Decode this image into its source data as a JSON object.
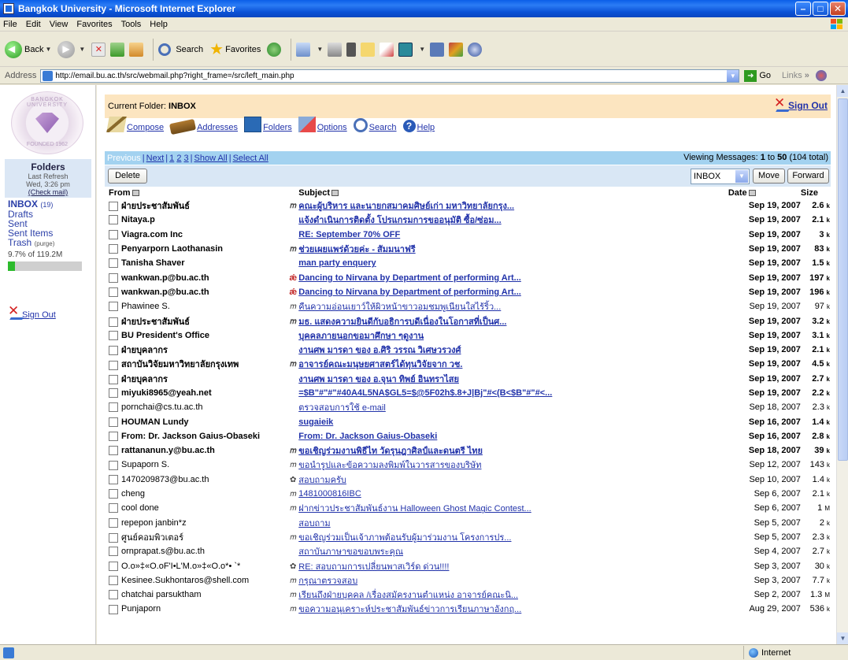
{
  "window": {
    "title": "Bangkok University - Microsoft Internet Explorer"
  },
  "menu": [
    "File",
    "Edit",
    "View",
    "Favorites",
    "Tools",
    "Help"
  ],
  "toolbar": {
    "back": "Back",
    "search": "Search",
    "favorites": "Favorites"
  },
  "address": {
    "label": "Address",
    "url": "http://email.bu.ac.th/src/webmail.php?right_frame=/src/left_main.php",
    "go": "Go",
    "links": "Links"
  },
  "left": {
    "seal_top": "BANGKOK UNIVERSITY",
    "seal_bottom": "FOUNDED 1962",
    "folders_title": "Folders",
    "last_refresh": "Last Refresh",
    "refresh_time": "Wed, 3:26 pm",
    "check_mail": "(Check mail)",
    "inbox": "INBOX",
    "inbox_count": "(19)",
    "drafts": "Drafts",
    "sent": "Sent",
    "sent_items": "Sent Items",
    "trash": "Trash",
    "purge": "(purge)",
    "quota": "9.7% of 119.2M",
    "quota_fraction": 0.097,
    "sign_out": "Sign Out"
  },
  "header": {
    "current_folder_label": "Current Folder:",
    "current_folder": "INBOX",
    "sign_out": "Sign Out"
  },
  "nav": {
    "compose": "Compose",
    "addresses": "Addresses",
    "folders": "Folders",
    "options": "Options",
    "search": "Search",
    "help": "Help"
  },
  "pager": {
    "previous": "Previous",
    "next": "Next",
    "p1": "1",
    "p2": "2",
    "p3": "3",
    "show_all": "Show All",
    "select_all": "Select All",
    "viewing_prefix": "Viewing Messages:",
    "viewing_range": "1",
    "viewing_to": "to",
    "viewing_end": "50",
    "viewing_total": "(104 total)"
  },
  "actions": {
    "delete": "Delete",
    "move_target": "INBOX",
    "move": "Move",
    "forward": "Forward"
  },
  "columns": {
    "from": "From",
    "subject": "Subject",
    "date": "Date",
    "size": "Size"
  },
  "messages": [
    {
      "from": "ฝ่ายประชาสัมพันธ์",
      "att": "clip",
      "subject": "คณะผู้บริหาร และนายกสมาคมศิษย์เก่า มหาวิทยาลัยกรุง...",
      "date": "Sep 19, 2007",
      "size": "2.6",
      "unit": "k",
      "unread": true
    },
    {
      "from": "Nitaya.p",
      "att": "",
      "subject": "แจ้งดำเนินการติดตั้ง โปรแกรมการขออนุมัติ ซื้อ/ซ่อม...",
      "date": "Sep 19, 2007",
      "size": "2.1",
      "unit": "k",
      "unread": true
    },
    {
      "from": "Viagra.com Inc",
      "att": "",
      "subject": "RE: September 70% OFF",
      "date": "Sep 19, 2007",
      "size": "3",
      "unit": "k",
      "unread": true
    },
    {
      "from": "Penyarporn Laothanasin",
      "att": "clip",
      "subject": "ช่วยเผยแพร่ด้วยค่ะ - สัมมนาฟรี",
      "date": "Sep 19, 2007",
      "size": "83",
      "unit": "k",
      "unread": true
    },
    {
      "from": "Tanisha Shaver",
      "att": "",
      "subject": "man party enquery",
      "date": "Sep 19, 2007",
      "size": "1.5",
      "unit": "k",
      "unread": true
    },
    {
      "from": "wankwan.p@bu.ac.th",
      "att": "flag",
      "subject": "Dancing to Nirvana by Department of performing Art...",
      "date": "Sep 19, 2007",
      "size": "197",
      "unit": "k",
      "unread": true
    },
    {
      "from": "wankwan.p@bu.ac.th",
      "att": "flag",
      "subject": "Dancing to Nirvana by Department of performing Art...",
      "date": "Sep 19, 2007",
      "size": "196",
      "unit": "k",
      "unread": true
    },
    {
      "from": "Phawinee S.",
      "att": "clip",
      "subject": "คืนความอ่อนเยาว์ให้ผิวหน้าขาวอมชมพูเนียนใสไร้ริ้ว...",
      "date": "Sep 19, 2007",
      "size": "97",
      "unit": "k",
      "unread": false
    },
    {
      "from": "ฝ่ายประชาสัมพันธ์",
      "att": "clip",
      "subject": "มธ. แสดงความยินดีกับอธิการบดีเนื่องในโอกาสที่เป็นศ...",
      "date": "Sep 19, 2007",
      "size": "3.2",
      "unit": "k",
      "unread": true
    },
    {
      "from": "BU President's Office",
      "att": "",
      "subject": "บุคคลภายนอกขอมาศึกษา ๆดูงาน",
      "date": "Sep 19, 2007",
      "size": "3.1",
      "unit": "k",
      "unread": true
    },
    {
      "from": "ฝ่ายบุคลากร",
      "att": "",
      "subject": "งานศพ มารดา ของ อ.ศิริ วรรณ วิเศษวรวงศ์",
      "date": "Sep 19, 2007",
      "size": "2.1",
      "unit": "k",
      "unread": true
    },
    {
      "from": "สถาบันวิจัยมหาวิทยาลัยกรุงเทพ",
      "att": "clip",
      "subject": "อาจารย์คณะมนุษยศาสตร์ได้ทุนวิจัยจาก วช.",
      "date": "Sep 19, 2007",
      "size": "4.5",
      "unit": "k",
      "unread": true
    },
    {
      "from": "ฝ่ายบุคลากร",
      "att": "",
      "subject": "งานศพ มารดา ของ อ.จุนา ทิพย์ อินทราไสย",
      "date": "Sep 19, 2007",
      "size": "2.7",
      "unit": "k",
      "unread": true
    },
    {
      "from": "miyuki8965@yeah.net",
      "att": "",
      "subject": "=$B\"#\"#\"#40A4L5NA$GL5=$@5F02h$.8+J|Bj\"#<(B<$B\"#\"#<...",
      "date": "Sep 19, 2007",
      "size": "2.2",
      "unit": "k",
      "unread": true
    },
    {
      "from": "pornchai@cs.tu.ac.th",
      "att": "",
      "subject": "ตรวจสอบการใช้ e-mail",
      "date": "Sep 18, 2007",
      "size": "2.3",
      "unit": "k",
      "unread": false
    },
    {
      "from": "HOUMAN Lundy",
      "att": "",
      "subject": "sugaieik",
      "date": "Sep 16, 2007",
      "size": "1.4",
      "unit": "k",
      "unread": true
    },
    {
      "from": "From: Dr. Jackson Gaius-Obaseki",
      "att": "",
      "subject": "From: Dr. Jackson Gaius-Obaseki",
      "date": "Sep 16, 2007",
      "size": "2.8",
      "unit": "k",
      "unread": true
    },
    {
      "from": "rattananun.y@bu.ac.th",
      "att": "clip",
      "subject": "ขอเชิญร่วมงานพิธีไท วัดรุนฎาศิลป์และดนตรี ไทย",
      "date": "Sep 18, 2007",
      "size": "39",
      "unit": "k",
      "unread": true
    },
    {
      "from": "Supaporn S.",
      "att": "clip",
      "subject": "ขอนำรูปและข้อความลงพิมพ์ในวารสารของบริษัท",
      "date": "Sep 12, 2007",
      "size": "143",
      "unit": "k",
      "unread": false
    },
    {
      "from": "1470209873@bu.ac.th",
      "att": "pic",
      "subject": "สอบถามครับ",
      "date": "Sep 10, 2007",
      "size": "1.4",
      "unit": "k",
      "unread": false
    },
    {
      "from": "cheng",
      "att": "clip",
      "subject": "1481000816IBC",
      "date": "Sep 6, 2007",
      "size": "2.1",
      "unit": "k",
      "unread": false
    },
    {
      "from": "cool done",
      "att": "clip",
      "subject": "ฝากข่าวประชาสัมพันธ์งาน Halloween Ghost Magic Contest...",
      "date": "Sep 6, 2007",
      "size": "1",
      "unit": "M",
      "unread": false
    },
    {
      "from": "repepon janbin*z",
      "att": "",
      "subject": "สอบถาม",
      "date": "Sep 5, 2007",
      "size": "2",
      "unit": "k",
      "unread": false
    },
    {
      "from": "ศูนย์คอมพิวเตอร์",
      "att": "clip",
      "subject": "ขอเชิญร่วมเป็นเจ้าภาพต้อนรับผู้มาร่วมงาน โครงการปร...",
      "date": "Sep 5, 2007",
      "size": "2.3",
      "unit": "k",
      "unread": false
    },
    {
      "from": "ornprapat.s@bu.ac.th",
      "att": "",
      "subject": "สถาบันภาษาขอขอบพระคุณ",
      "date": "Sep 4, 2007",
      "size": "2.7",
      "unit": "k",
      "unread": false
    },
    {
      "from": "O.o»‡«O.oF'I•L'M.o»‡«O.o*• `*",
      "att": "picclip",
      "subject": "RE: สอบถามการเปลี่ยนพาสเวิร์ด ด่วน!!!!",
      "date": "Sep 3, 2007",
      "size": "30",
      "unit": "k",
      "unread": false
    },
    {
      "from": "Kesinee.Sukhontaros@shell.com",
      "att": "clip",
      "subject": "กรุณาตรวจสอบ",
      "date": "Sep 3, 2007",
      "size": "7.7",
      "unit": "k",
      "unread": false
    },
    {
      "from": "chatchai parsuktham",
      "att": "clip",
      "subject": "เรียนถึงฝ่ายบุคคล /เรื่องสมัครงานตำแหน่ง อาจารย์คณะนิ...",
      "date": "Sep 2, 2007",
      "size": "1.3",
      "unit": "M",
      "unread": false
    },
    {
      "from": "Punjaporn",
      "att": "clip",
      "subject": "ขอความอนุเคราะห์ประชาสัมพันธ์ข่าวการเรียนภาษาอังกฤ...",
      "date": "Aug 29, 2007",
      "size": "536",
      "unit": "k",
      "unread": false
    }
  ],
  "status": {
    "zone": "Internet"
  }
}
